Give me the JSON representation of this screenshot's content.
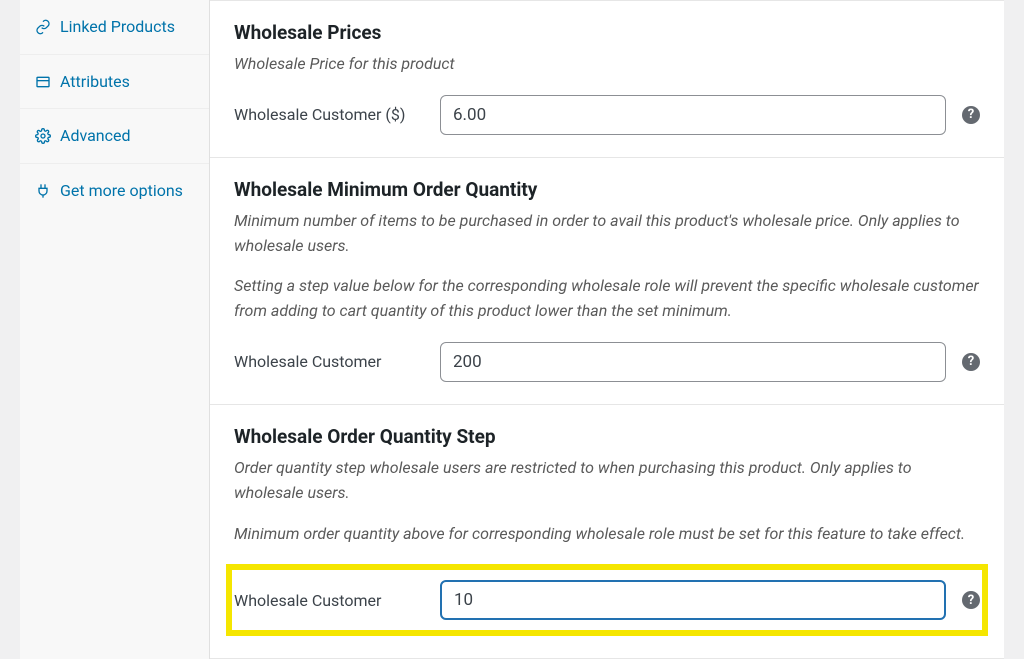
{
  "sidebar": {
    "items": [
      {
        "label": "Linked Products",
        "icon": "link"
      },
      {
        "label": "Attributes",
        "icon": "card"
      },
      {
        "label": "Advanced",
        "icon": "gear"
      },
      {
        "label": "Get more options",
        "icon": "plug"
      }
    ]
  },
  "sections": {
    "prices": {
      "title": "Wholesale Prices",
      "help1": "Wholesale Price for this product",
      "field_label": "Wholesale Customer ($)",
      "value": "6.00"
    },
    "minqty": {
      "title": "Wholesale Minimum Order Quantity",
      "help1": "Minimum number of items to be purchased in order to avail this product's wholesale price. Only applies to wholesale users.",
      "help2": "Setting a step value below for the corresponding wholesale role will prevent the specific wholesale customer from adding to cart quantity of this product lower than the set minimum.",
      "field_label": "Wholesale Customer",
      "value": "200"
    },
    "step": {
      "title": "Wholesale Order Quantity Step",
      "help1": "Order quantity step wholesale users are restricted to when purchasing this product. Only applies to wholesale users.",
      "help2": "Minimum order quantity above for corresponding wholesale role must be set for this feature to take effect.",
      "field_label": "Wholesale Customer",
      "value": "10"
    }
  }
}
